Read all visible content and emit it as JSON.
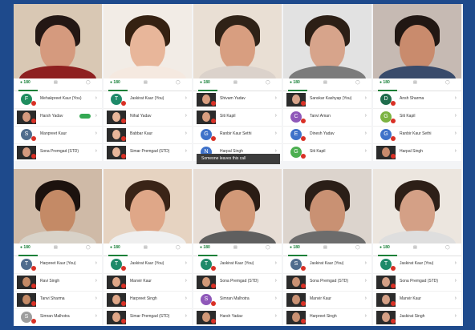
{
  "tabs": {
    "people_label": "180"
  },
  "toast": {
    "text": "Someone leaves this call"
  },
  "colors": {
    "accent": "#188038",
    "mic_off": "#d93025",
    "background": "#1e4a8c"
  },
  "cells": [
    {
      "bg": "#d9c8b4",
      "skin": "#d59a7e",
      "hair": "#231714",
      "shirt": "#8e2020",
      "rows": [
        {
          "type": "avatar",
          "letter": "F",
          "color": "#1f8d5f",
          "name": "Mehakpreet Kaur (You)"
        },
        {
          "type": "thumb",
          "name": "Harsh Yadav",
          "pill": true
        },
        {
          "type": "avatar",
          "letter": "S",
          "color": "#4f6c8d",
          "name": "Manpreet Kaur"
        },
        {
          "type": "thumb",
          "name": "Sona Premgad (STD)"
        }
      ]
    },
    {
      "bg": "#f2ece6",
      "skin": "#e8b69a",
      "hair": "#352112",
      "shirt": "#f5e9e0",
      "rows": [
        {
          "type": "avatar",
          "letter": "T",
          "color": "#1e8a69",
          "name": "Jaskirat Kaur (You)"
        },
        {
          "type": "thumb",
          "name": "Nihal Yadav"
        },
        {
          "type": "thumb",
          "name": "Babbar Kaur"
        },
        {
          "type": "thumb",
          "name": "Simar Premgad (STD)"
        }
      ]
    },
    {
      "bg": "#e9dfd4",
      "skin": "#d89e80",
      "hair": "#2f2217",
      "shirt": "#dbd2cb",
      "rows": [
        {
          "type": "thumb",
          "name": "Shivam Yadav"
        },
        {
          "type": "thumb",
          "name": "Siti Kapil"
        },
        {
          "type": "avatar",
          "letter": "G",
          "color": "#3f72c9",
          "name": "Ranbir Kaur Sethi"
        },
        {
          "type": "avatar",
          "letter": "N",
          "color": "#3f72c9",
          "name": "Harpal Singh"
        }
      ]
    },
    {
      "bg": "#e2e2e2",
      "skin": "#d7a48b",
      "hair": "#2c1f16",
      "shirt": "#7b7b7b",
      "rows": [
        {
          "type": "thumb",
          "name": "Sanskar Kashyap (You)"
        },
        {
          "type": "avatar",
          "letter": "C",
          "color": "#8f58b9",
          "name": "Tanvi Aman"
        },
        {
          "type": "avatar",
          "letter": "E",
          "color": "#3f72c9",
          "name": "Dinesh Yadav"
        },
        {
          "type": "avatar",
          "letter": "G",
          "color": "#4caf50",
          "name": "Siti Kapil"
        }
      ]
    },
    {
      "bg": "#c6bab3",
      "skin": "#c98b6d",
      "hair": "#211713",
      "shirt": "#394b6b",
      "rows": [
        {
          "type": "avatar",
          "letter": "D",
          "color": "#1f6d4d",
          "name": "Ansh Sharma"
        },
        {
          "type": "avatar",
          "letter": "G",
          "color": "#7cb342",
          "name": "Siti Kapil"
        },
        {
          "type": "avatar",
          "letter": "G",
          "color": "#3f72c9",
          "name": "Ranbir Kaur Sethi"
        },
        {
          "type": "thumb",
          "name": "Harpal Singh"
        }
      ]
    },
    {
      "bg": "#cfbaa7",
      "skin": "#c48a66",
      "hair": "#1c120e",
      "shirt": "#d8d2c8",
      "rows": [
        {
          "type": "avatar",
          "letter": "T",
          "color": "#4f6c8d",
          "name": "Harpreet Kaur (You)"
        },
        {
          "type": "thumb",
          "name": "Ravi Singh"
        },
        {
          "type": "thumb",
          "name": "Tanvi Sharma"
        },
        {
          "type": "avatar",
          "letter": "S",
          "color": "#9e9e9e",
          "name": "Simran Malhotra"
        }
      ]
    },
    {
      "bg": "#e6d3c1",
      "skin": "#dfa788",
      "hair": "#3a2417",
      "shirt": "#efefef",
      "rows": [
        {
          "type": "avatar",
          "letter": "T",
          "color": "#1e8a69",
          "name": "Jaskirat Kaur (You)"
        },
        {
          "type": "thumb",
          "name": "Manvir Kaur"
        },
        {
          "type": "thumb",
          "name": "Harpreet Singh"
        },
        {
          "type": "thumb",
          "name": "Simar Premgad (STD)"
        }
      ]
    },
    {
      "bg": "#e7ddd5",
      "skin": "#d29978",
      "hair": "#2a1c14",
      "shirt": "#5f5f5f",
      "rows": [
        {
          "type": "avatar",
          "letter": "T",
          "color": "#1e8a69",
          "name": "Jaskirat Kaur (You)"
        },
        {
          "type": "thumb",
          "name": "Sona Premgad (STD)"
        },
        {
          "type": "avatar",
          "letter": "S",
          "color": "#8f58b9",
          "name": "Simran Malhotra"
        },
        {
          "type": "thumb",
          "name": "Harsh Yadav"
        }
      ]
    },
    {
      "bg": "#dcd4cd",
      "skin": "#c99173",
      "hair": "#2a1e17",
      "shirt": "#6c6c6c",
      "rows": [
        {
          "type": "avatar",
          "letter": "S",
          "color": "#4f6c8d",
          "name": "Jaskirat Kaur (You)"
        },
        {
          "type": "thumb",
          "name": "Sona Premgad (STD)"
        },
        {
          "type": "thumb",
          "name": "Manvir Kaur"
        },
        {
          "type": "thumb",
          "name": "Harpreet Singh"
        }
      ]
    },
    {
      "bg": "#ece6df",
      "skin": "#d4a086",
      "hair": "#2d1f17",
      "shirt": "#dedede",
      "rows": [
        {
          "type": "avatar",
          "letter": "T",
          "color": "#1e8a69",
          "name": "Jaskirat Kaur (You)"
        },
        {
          "type": "thumb",
          "name": "Sona Premgad (STD)"
        },
        {
          "type": "thumb",
          "name": "Manvir Kaur"
        },
        {
          "type": "thumb",
          "name": "Jaskirat Singh"
        }
      ]
    }
  ]
}
